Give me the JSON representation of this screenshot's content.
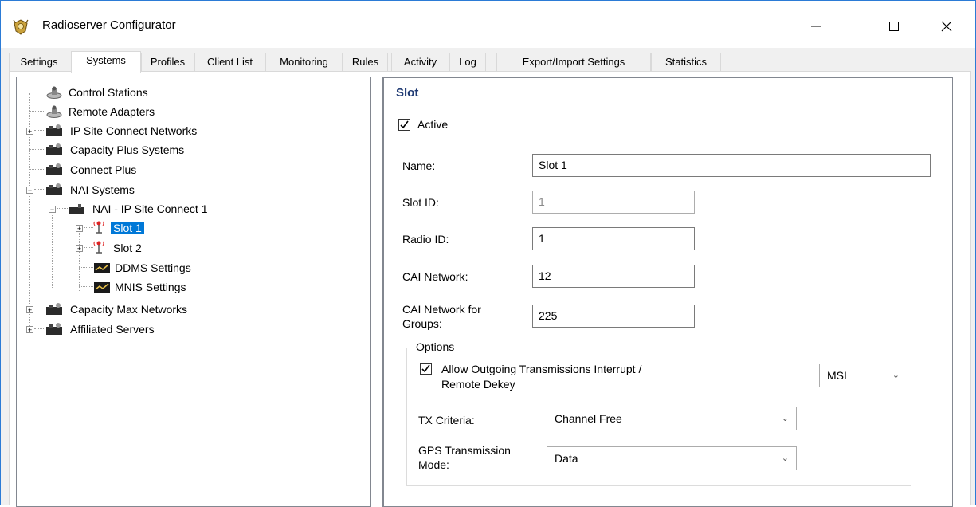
{
  "window": {
    "title": "Radioserver Configurator",
    "controls": {
      "minimize": "—",
      "maximize": "☐",
      "close": "✕"
    }
  },
  "tabs": [
    {
      "label": "Settings"
    },
    {
      "label": "Systems"
    },
    {
      "label": "Profiles"
    },
    {
      "label": "Client List"
    },
    {
      "label": "Monitoring"
    },
    {
      "label": "Rules"
    },
    {
      "label": "Activity"
    },
    {
      "label": "Log"
    },
    {
      "label": "Export/Import Settings"
    },
    {
      "label": "Statistics"
    }
  ],
  "active_tab": "Systems",
  "tree": {
    "items": [
      {
        "label": "Control Stations",
        "icon": "station-icon"
      },
      {
        "label": "Remote Adapters",
        "icon": "station-icon"
      },
      {
        "label": "IP Site Connect Networks",
        "icon": "network-icon",
        "expander": "+"
      },
      {
        "label": "Capacity Plus Systems",
        "icon": "network-icon"
      },
      {
        "label": "Connect Plus",
        "icon": "network-icon"
      },
      {
        "label": "NAI Systems",
        "icon": "network-icon",
        "expander": "−"
      },
      {
        "label": "NAI - IP Site Connect 1",
        "icon": "system-icon",
        "expander": "−"
      },
      {
        "label": "Slot 1",
        "icon": "antenna-icon",
        "expander": "+",
        "selected": true
      },
      {
        "label": "Slot 2",
        "icon": "antenna-icon",
        "expander": "+"
      },
      {
        "label": "DDMS Settings",
        "icon": "settings-monitor-icon"
      },
      {
        "label": "MNIS Settings",
        "icon": "settings-monitor-icon"
      },
      {
        "label": "Capacity Max Networks",
        "icon": "network-icon",
        "expander": "+"
      },
      {
        "label": "Affiliated Servers",
        "icon": "network-icon",
        "expander": "+"
      }
    ]
  },
  "slot": {
    "heading": "Slot",
    "active_label": "Active",
    "active_checked": true,
    "name_label": "Name:",
    "name_value": "Slot 1",
    "slot_id_label": "Slot ID:",
    "slot_id_value": "1",
    "radio_id_label": "Radio ID:",
    "radio_id_value": "1",
    "cai_network_label": "CAI Network:",
    "cai_network_value": "12",
    "cai_groups_label_1": "CAI Network for",
    "cai_groups_label_2": "Groups:",
    "cai_groups_value": "225",
    "options": {
      "title": "Options",
      "allow_interrupt_label_1": "Allow Outgoing Transmissions Interrupt /",
      "allow_interrupt_label_2": "Remote Dekey",
      "allow_interrupt_checked": true,
      "interrupt_mode_value": "MSI",
      "tx_criteria_label": "TX Criteria:",
      "tx_criteria_value": "Channel Free",
      "gps_mode_label_1": "GPS Transmission",
      "gps_mode_label_2": "Mode:",
      "gps_mode_value": "Data"
    }
  },
  "colors": {
    "accent": "#0078d7",
    "heading": "#1f3a73",
    "window_border": "#2b7bd6"
  }
}
